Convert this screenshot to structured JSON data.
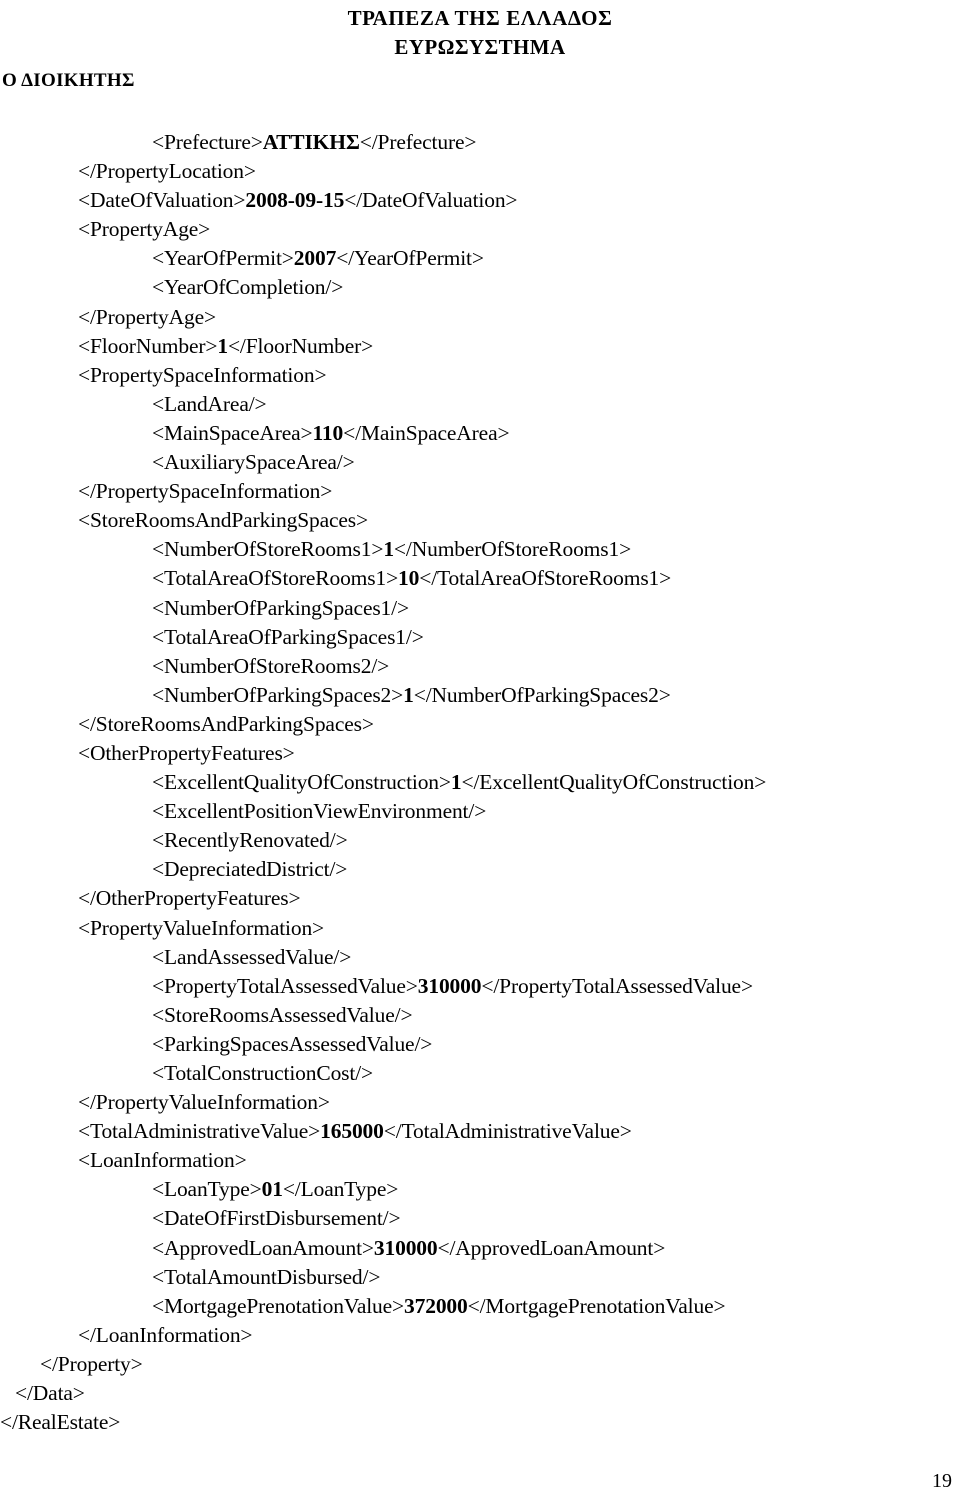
{
  "header": {
    "bank_name": "ΤΡΑΠΕΖΑ ΤΗΣ ΕΛΛΑΔΟΣ",
    "eurosystem": "ΕΥΡΩΣΥΣΤΗΜΑ",
    "governor_label": "Ο ΔΙΟΙΚΗΤΗΣ"
  },
  "xml_listing": {
    "lines": [
      {
        "indent": "ind-2",
        "pre": "<Prefecture>",
        "value": "ΑΤΤΙΚΗΣ",
        "post": "</Prefecture>"
      },
      {
        "indent": "ind-1",
        "pre": "</PropertyLocation>",
        "value": "",
        "post": ""
      },
      {
        "indent": "ind-1",
        "pre": "<DateOfValuation>",
        "value": "2008-09-15",
        "post": "</DateOfValuation>"
      },
      {
        "indent": "ind-1",
        "pre": "<PropertyAge>",
        "value": "",
        "post": ""
      },
      {
        "indent": "ind-2",
        "pre": "<YearOfPermit>",
        "value": "2007",
        "post": "</YearOfPermit>"
      },
      {
        "indent": "ind-2",
        "pre": "<YearOfCompletion/>",
        "value": "",
        "post": ""
      },
      {
        "indent": "ind-1",
        "pre": "</PropertyAge>",
        "value": "",
        "post": ""
      },
      {
        "indent": "ind-1",
        "pre": "<FloorNumber>",
        "value": "1",
        "post": "</FloorNumber>"
      },
      {
        "indent": "ind-1",
        "pre": "<PropertySpaceInformation>",
        "value": "",
        "post": ""
      },
      {
        "indent": "ind-2",
        "pre": "<LandArea/>",
        "value": "",
        "post": ""
      },
      {
        "indent": "ind-2",
        "pre": "<MainSpaceArea>",
        "value": "110",
        "post": "</MainSpaceArea>"
      },
      {
        "indent": "ind-2",
        "pre": "<AuxiliarySpaceArea/>",
        "value": "",
        "post": ""
      },
      {
        "indent": "ind-1",
        "pre": "</PropertySpaceInformation>",
        "value": "",
        "post": ""
      },
      {
        "indent": "ind-1",
        "pre": "<StoreRoomsAndParkingSpaces>",
        "value": "",
        "post": ""
      },
      {
        "indent": "ind-2",
        "pre": "<NumberOfStoreRooms1>",
        "value": "1",
        "post": "</NumberOfStoreRooms1>"
      },
      {
        "indent": "ind-2",
        "pre": "<TotalAreaOfStoreRooms1>",
        "value": "10",
        "post": "</TotalAreaOfStoreRooms1>"
      },
      {
        "indent": "ind-2",
        "pre": "<NumberOfParkingSpaces1/>",
        "value": "",
        "post": ""
      },
      {
        "indent": "ind-2",
        "pre": "<TotalAreaOfParkingSpaces1/>",
        "value": "",
        "post": ""
      },
      {
        "indent": "ind-2",
        "pre": "<NumberOfStoreRooms2/>",
        "value": "",
        "post": ""
      },
      {
        "indent": "ind-2",
        "pre": "<NumberOfParkingSpaces2>",
        "value": "1",
        "post": "</NumberOfParkingSpaces2>"
      },
      {
        "indent": "ind-1",
        "pre": "</StoreRoomsAndParkingSpaces>",
        "value": "",
        "post": ""
      },
      {
        "indent": "ind-1",
        "pre": "<OtherPropertyFeatures>",
        "value": "",
        "post": ""
      },
      {
        "indent": "ind-2",
        "pre": "<ExcellentQualityOfConstruction>",
        "value": "1",
        "post": "</ExcellentQualityOfConstruction>"
      },
      {
        "indent": "ind-2",
        "pre": "<ExcellentPositionViewEnvironment/>",
        "value": "",
        "post": ""
      },
      {
        "indent": "ind-2",
        "pre": "<RecentlyRenovated/>",
        "value": "",
        "post": ""
      },
      {
        "indent": "ind-2",
        "pre": "<DepreciatedDistrict/>",
        "value": "",
        "post": ""
      },
      {
        "indent": "ind-1",
        "pre": "</OtherPropertyFeatures>",
        "value": "",
        "post": ""
      },
      {
        "indent": "ind-1",
        "pre": "<PropertyValueInformation>",
        "value": "",
        "post": ""
      },
      {
        "indent": "ind-2",
        "pre": "<LandAssessedValue/>",
        "value": "",
        "post": ""
      },
      {
        "indent": "ind-2",
        "pre": "<PropertyTotalAssessedValue>",
        "value": "310000",
        "post": "</PropertyTotalAssessedValue>"
      },
      {
        "indent": "ind-2",
        "pre": "<StoreRoomsAssessedValue/>",
        "value": "",
        "post": ""
      },
      {
        "indent": "ind-2",
        "pre": "<ParkingSpacesAssessedValue/>",
        "value": "",
        "post": ""
      },
      {
        "indent": "ind-2",
        "pre": "<TotalConstructionCost/>",
        "value": "",
        "post": ""
      },
      {
        "indent": "ind-1",
        "pre": "</PropertyValueInformation>",
        "value": "",
        "post": ""
      },
      {
        "indent": "ind-1",
        "pre": "<TotalAdministrativeValue>",
        "value": "165000",
        "post": "</TotalAdministrativeValue>"
      },
      {
        "indent": "ind-1",
        "pre": "<LoanInformation>",
        "value": "",
        "post": ""
      },
      {
        "indent": "ind-2",
        "pre": "<LoanType>",
        "value": "01",
        "post": "</LoanType>"
      },
      {
        "indent": "ind-2",
        "pre": "<DateOfFirstDisbursement/>",
        "value": "",
        "post": ""
      },
      {
        "indent": "ind-2",
        "pre": "<ApprovedLoanAmount>",
        "value": "310000",
        "post": "</ApprovedLoanAmount>"
      },
      {
        "indent": "ind-2",
        "pre": "<TotalAmountDisbursed/>",
        "value": "",
        "post": ""
      },
      {
        "indent": "ind-2",
        "pre": "<MortgagePrenotationValue>",
        "value": "372000",
        "post": "</MortgagePrenotationValue>"
      },
      {
        "indent": "ind-1",
        "pre": "</LoanInformation>",
        "value": "",
        "post": ""
      },
      {
        "indent": "ind-d2",
        "pre": "</Property>",
        "value": "",
        "post": ""
      },
      {
        "indent": "ind-d1",
        "pre": "</Data>",
        "value": "",
        "post": ""
      },
      {
        "indent": "ind-0",
        "pre": "</RealEstate>",
        "value": "",
        "post": ""
      }
    ]
  },
  "footer": {
    "page_number": "19"
  }
}
